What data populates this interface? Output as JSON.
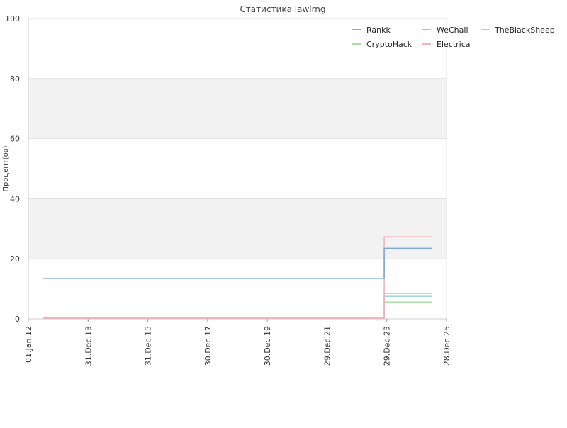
{
  "chart_data": {
    "type": "line",
    "title": "Статистика lawlrng",
    "ylabel": "Процент(ов)",
    "ylim": [
      0,
      100
    ],
    "y_ticks": [
      0,
      20,
      40,
      60,
      80,
      100
    ],
    "xlim": [
      "2012-01-01",
      "2025-12-28"
    ],
    "x_ticks": [
      {
        "date": "2012-01-01",
        "label": "01.Jan.12"
      },
      {
        "date": "2013-12-31",
        "label": "31.Dec.13"
      },
      {
        "date": "2015-12-31",
        "label": "31.Dec.15"
      },
      {
        "date": "2017-12-30",
        "label": "30.Dec.17"
      },
      {
        "date": "2019-12-30",
        "label": "30.Dec.19"
      },
      {
        "date": "2021-12-29",
        "label": "29.Dec.21"
      },
      {
        "date": "2023-12-29",
        "label": "29.Dec.23"
      },
      {
        "date": "2025-12-28",
        "label": "28.Dec.25"
      }
    ],
    "grid": "horizontal, alternating bands",
    "legend_position": "top-right",
    "series": [
      {
        "name": "Rankk",
        "color": "#7aa9e6",
        "points": [
          [
            "2012-07-01",
            13.5
          ],
          [
            "2023-11-20",
            13.5
          ],
          [
            "2023-11-28",
            23.5
          ],
          [
            "2025-07-01",
            23.5
          ]
        ]
      },
      {
        "name": "WeChall",
        "color": "#e0a8c8",
        "points": [
          [
            "2012-07-01",
            0.2
          ],
          [
            "2023-11-20",
            0.2
          ],
          [
            "2023-11-28",
            8.5
          ],
          [
            "2025-07-01",
            8.5
          ]
        ]
      },
      {
        "name": "TheBlackSheep",
        "color": "#9fd8e0",
        "points": [
          [
            "2012-07-01",
            0.2
          ],
          [
            "2023-11-20",
            0.2
          ],
          [
            "2023-11-28",
            7.5
          ],
          [
            "2025-07-01",
            7.5
          ]
        ]
      },
      {
        "name": "CryptoHack",
        "color": "#a8e0a0",
        "points": [
          [
            "2012-07-01",
            0.3
          ],
          [
            "2023-11-20",
            0.3
          ],
          [
            "2023-11-28",
            5.6
          ],
          [
            "2025-07-01",
            5.6
          ]
        ]
      },
      {
        "name": "Electrica",
        "color": "#f5b3bc",
        "points": [
          [
            "2012-07-01",
            0.1
          ],
          [
            "2023-11-20",
            0.1
          ],
          [
            "2023-11-28",
            27.3
          ],
          [
            "2025-07-01",
            27.3
          ]
        ]
      }
    ]
  }
}
